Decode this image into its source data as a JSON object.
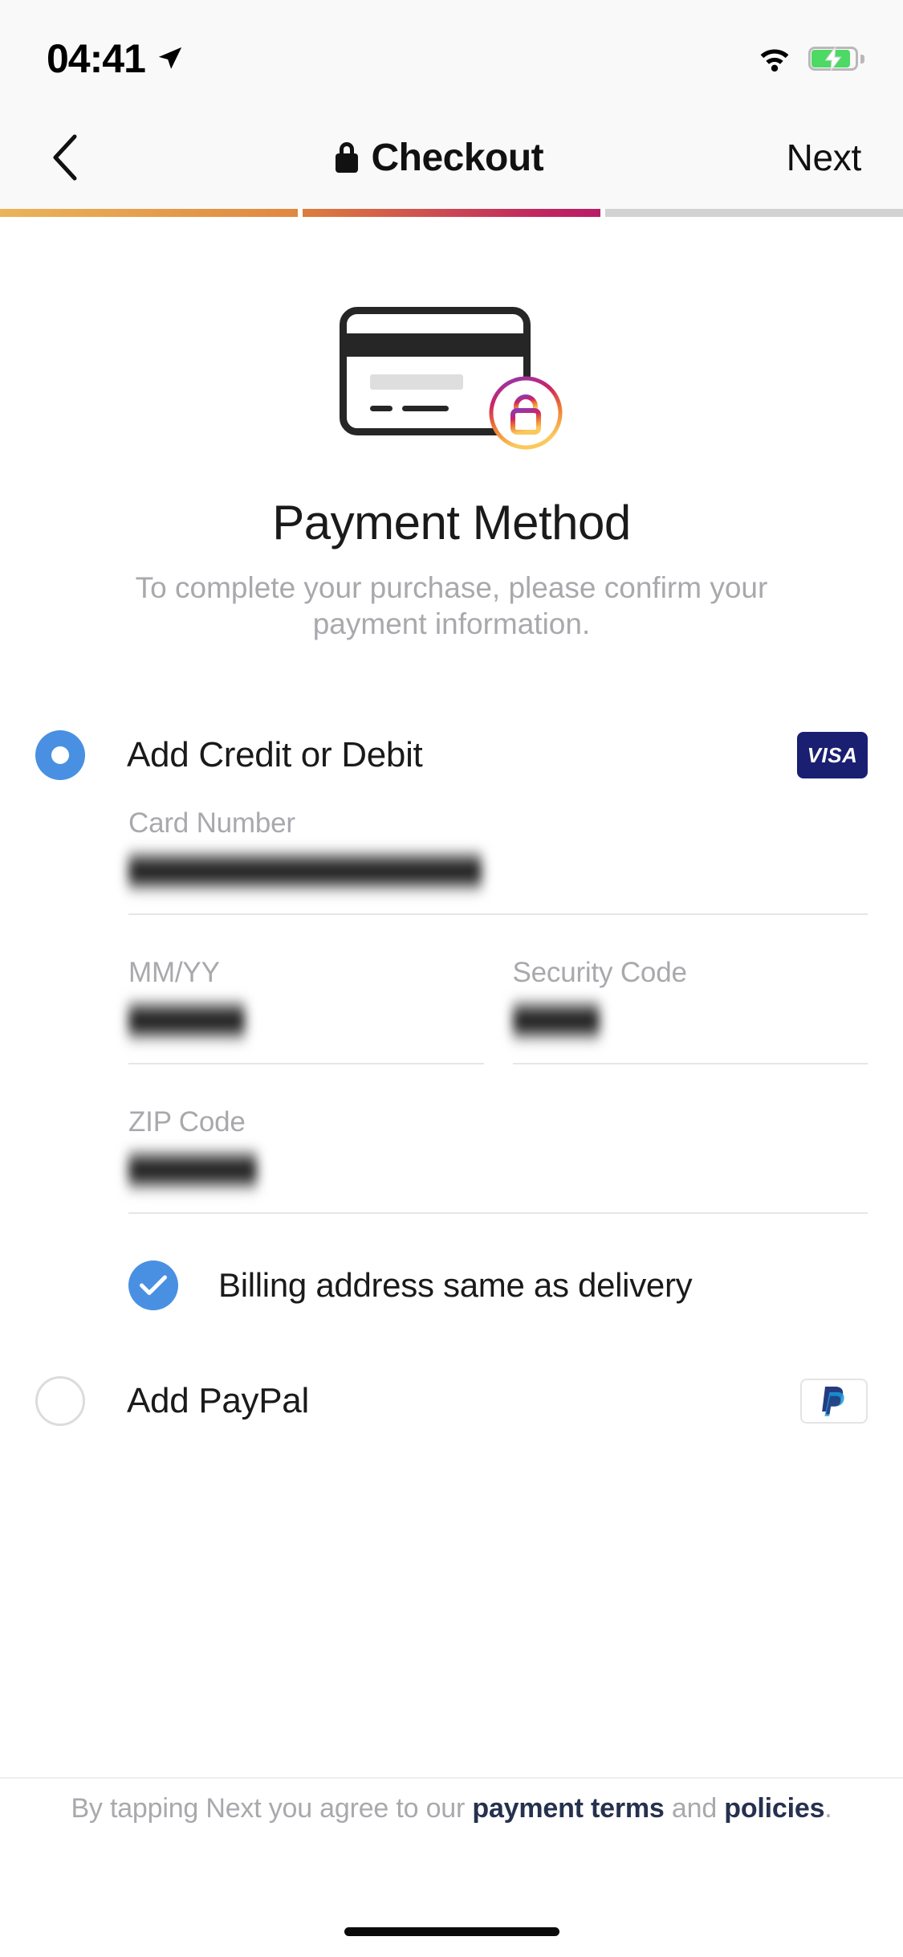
{
  "status_bar": {
    "time": "04:41",
    "location_icon": "location-arrow-icon",
    "wifi_icon": "wifi-icon",
    "battery_icon": "battery-charging-icon"
  },
  "nav": {
    "back_icon": "chevron-left-icon",
    "lock_icon": "lock-icon",
    "title": "Checkout",
    "next_label": "Next"
  },
  "progress": {
    "segments": [
      {
        "state": "complete",
        "color": "#e08840"
      },
      {
        "state": "current",
        "color": "#b81d67"
      },
      {
        "state": "upcoming",
        "color": "#d2d2d2"
      }
    ]
  },
  "hero": {
    "illustration": "credit-card-with-lock-icon",
    "title": "Payment Method",
    "subtitle": "To complete your purchase, please confirm your payment information."
  },
  "options": {
    "credit": {
      "label": "Add Credit or Debit",
      "selected": true,
      "badge_text": "VISA",
      "badge_name": "visa-logo",
      "badge_color": "#1a1f71"
    },
    "paypal": {
      "label": "Add PayPal",
      "selected": false,
      "badge_name": "paypal-logo",
      "badge_color": "#253b80"
    }
  },
  "form": {
    "card_number": {
      "label": "Card Number",
      "value": "",
      "placeholder": "",
      "redacted": true
    },
    "expiry": {
      "label": "MM/YY",
      "value": "",
      "placeholder": "",
      "redacted": true
    },
    "security_code": {
      "label": "Security Code",
      "value": "",
      "placeholder": "",
      "redacted": true
    },
    "zip_code": {
      "label": "ZIP Code",
      "value": "",
      "placeholder": "",
      "redacted": true
    },
    "billing_same": {
      "label": "Billing address same as delivery",
      "checked": true,
      "accent": "#4a90e2"
    }
  },
  "footer": {
    "text_before": "By tapping Next you agree to our ",
    "link_terms": "payment terms",
    "text_middle": " and ",
    "link_policies": "policies",
    "text_after": "."
  }
}
